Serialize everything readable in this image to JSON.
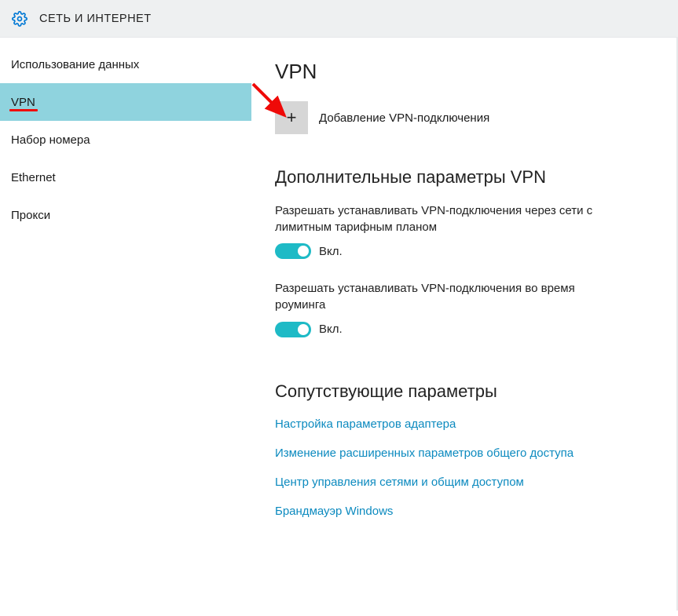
{
  "header": {
    "title": "СЕТЬ И ИНТЕРНЕТ"
  },
  "sidebar": {
    "items": [
      {
        "label": "Использование данных",
        "active": false
      },
      {
        "label": "VPN",
        "active": true
      },
      {
        "label": "Набор номера",
        "active": false
      },
      {
        "label": "Ethernet",
        "active": false
      },
      {
        "label": "Прокси",
        "active": false
      }
    ]
  },
  "content": {
    "page_title": "VPN",
    "add_vpn_label": "Добавление VPN-подключения",
    "advanced_title": "Дополнительные параметры VPN",
    "setting1_label": "Разрешать устанавливать VPN-подключения через сети с лимитным тарифным планом",
    "setting1_toggle": "Вкл.",
    "setting2_label": "Разрешать устанавливать VPN-подключения во время роуминга",
    "setting2_toggle": "Вкл.",
    "related_title": "Сопутствующие параметры",
    "links": [
      "Настройка параметров адаптера",
      "Изменение расширенных параметров общего доступа",
      "Центр управления сетями и общим доступом",
      "Брандмауэр Windows"
    ]
  },
  "colors": {
    "accent_teal": "#1ebac6",
    "link_blue": "#0c8abf",
    "sidebar_active": "#8fd3de",
    "annotation_red": "#ef0a08"
  }
}
